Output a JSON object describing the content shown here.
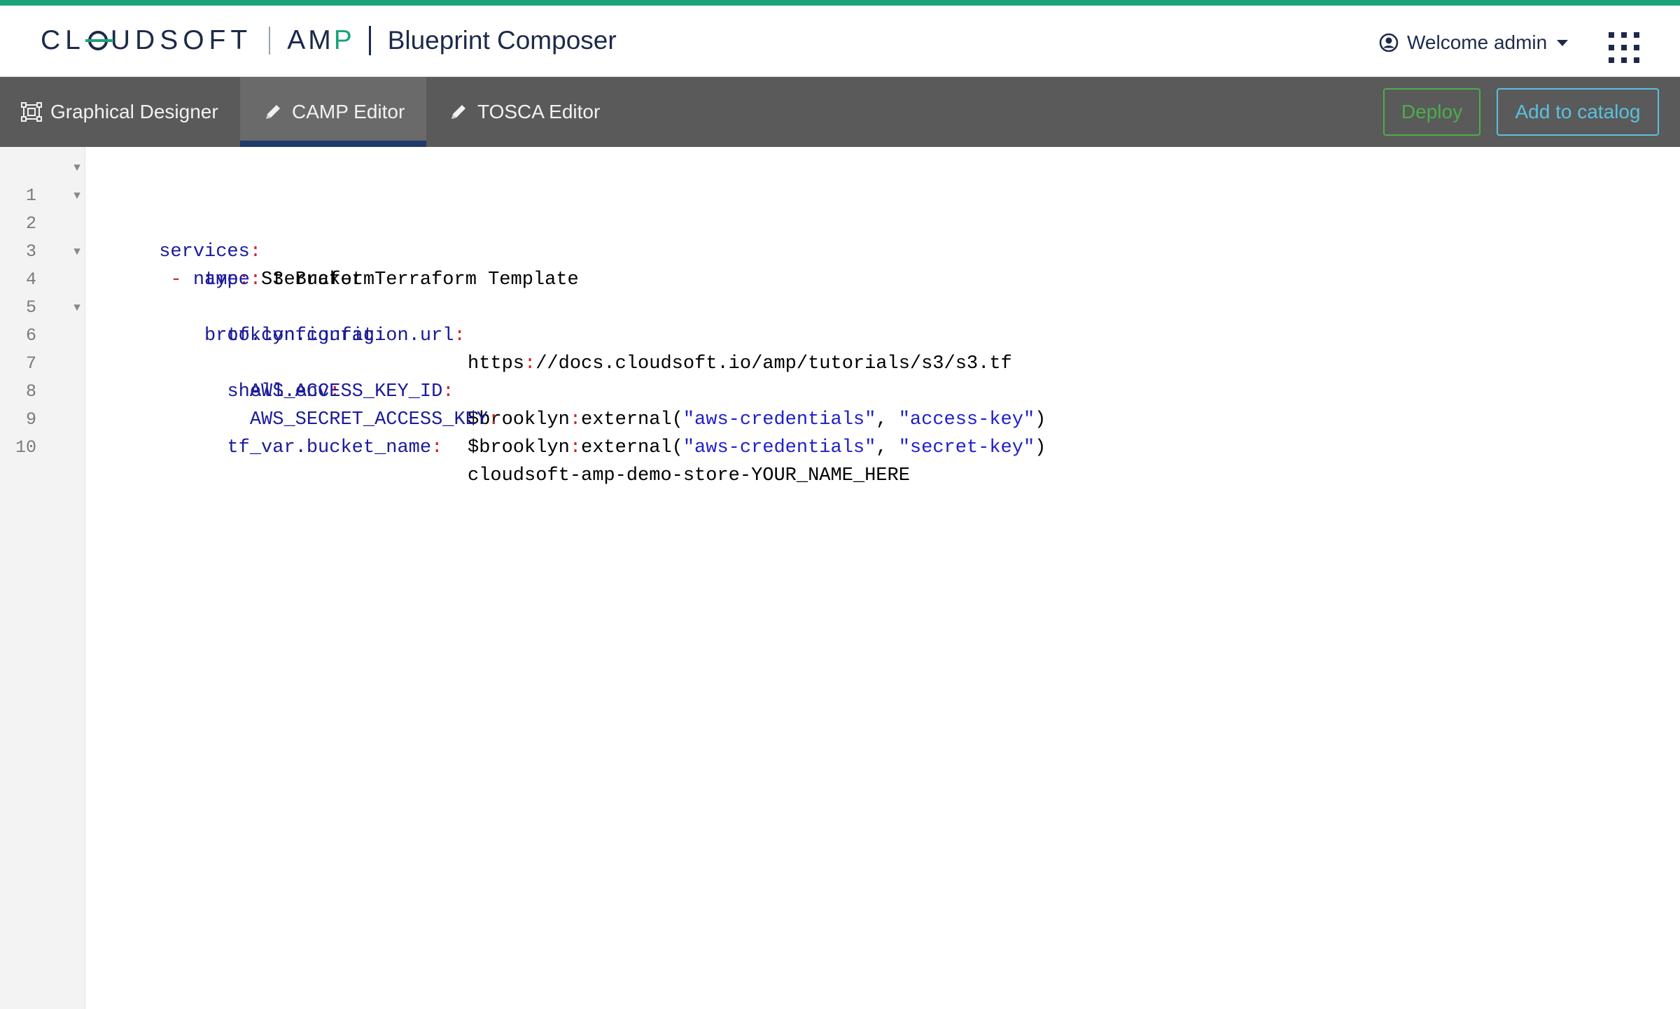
{
  "header": {
    "logo_word_left": "CL",
    "logo_word_right": "UDSOFT",
    "logo_amp": "AM",
    "logo_amp_p": "P",
    "product_title": "Blueprint Composer",
    "user_label": "Welcome admin"
  },
  "tabs": [
    {
      "label": "Graphical Designer",
      "active": false
    },
    {
      "label": "CAMP Editor",
      "active": true
    },
    {
      "label": "TOSCA Editor",
      "active": false
    }
  ],
  "actions": {
    "deploy_label": "Deploy",
    "catalog_label": "Add to catalog"
  },
  "colors": {
    "accent_green": "#1aa37a",
    "navy": "#1c2a4a",
    "toolbar_bg": "#5a5a5a",
    "deploy_green": "#4cae4c",
    "catalog_blue": "#5bc0de",
    "yaml_key": "#1b1b9a",
    "yaml_colon": "#d32020",
    "yaml_string": "#2020c8"
  },
  "editor": {
    "lines": [
      {
        "n": "1",
        "fold": true,
        "indent": "",
        "dash": "",
        "key": "services",
        "value": ""
      },
      {
        "n": "2",
        "fold": true,
        "indent": " ",
        "dash": "-",
        "key": "name",
        "value": "S3 Bucket Terraform Template"
      },
      {
        "n": "3",
        "fold": false,
        "indent": "    ",
        "dash": "",
        "key": "type",
        "value": "terraform"
      },
      {
        "n": "4",
        "fold": true,
        "indent": "    ",
        "dash": "",
        "key": "brooklyn.config",
        "value": ""
      },
      {
        "n": "5",
        "fold": false,
        "indent": "      ",
        "dash": "",
        "key": "tf.configuration.url",
        "value_prefix": "https",
        "value_colon": ":",
        "value_rest": "//docs.cloudsoft.io/amp/tutorials/s3/s3.tf"
      },
      {
        "n": "6",
        "fold": true,
        "indent": "      ",
        "dash": "",
        "key": "shell.env",
        "value": ""
      },
      {
        "n": "7",
        "fold": false,
        "indent": "        ",
        "dash": "",
        "key": "AWS_ACCESS_KEY_ID",
        "fn_prefix": "$brooklyn",
        "fn_colon": ":",
        "fn_name": "external(",
        "arg1": "\"aws-credentials\"",
        "sep": ", ",
        "arg2": "\"access-key\"",
        "fn_close": ")"
      },
      {
        "n": "8",
        "fold": false,
        "indent": "        ",
        "dash": "",
        "key": "AWS_SECRET_ACCESS_KEY",
        "fn_prefix": "$brooklyn",
        "fn_colon": ":",
        "fn_name": "external(",
        "arg1": "\"aws-credentials\"",
        "sep": ", ",
        "arg2": "\"secret-key\"",
        "fn_close": ")"
      },
      {
        "n": "9",
        "fold": false,
        "indent": "      ",
        "dash": "",
        "key": "tf_var.bucket_name",
        "value": "cloudsoft-amp-demo-store-YOUR_NAME_HERE"
      },
      {
        "n": "10",
        "fold": false,
        "indent": "",
        "dash": "",
        "key": "",
        "value": ""
      }
    ]
  }
}
